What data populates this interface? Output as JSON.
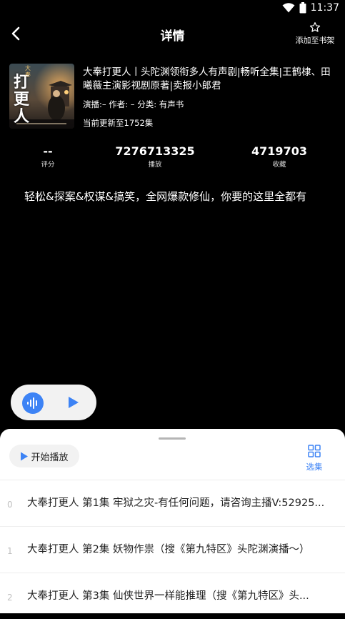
{
  "status": {
    "time": "11:37"
  },
  "nav": {
    "title": "详情",
    "shelf_label": "添加至书架"
  },
  "book": {
    "title": "大奉打更人丨头陀渊领衔多人有声剧|畅听全集|王鹤棣、田曦薇主演影视剧原著|卖报小郎君",
    "meta": "演播:–  作者: –  分类: 有声书",
    "update": "当前更新至1752集",
    "cover_text": {
      "main": "打更人",
      "top": "大奉"
    }
  },
  "stats": [
    {
      "value": "--",
      "label": "评分"
    },
    {
      "value": "7276713325",
      "label": "播放"
    },
    {
      "value": "4719703",
      "label": "收藏"
    }
  ],
  "description": "轻松&探案&权谋&搞笑，全网爆款修仙，你要的这里全都有",
  "sheet": {
    "start_label": "开始播放",
    "select_label": "选集",
    "episodes": [
      {
        "index": "0",
        "title": "大奉打更人 第1集 牢狱之灾-有任何问题，请咨询主播V:52925..."
      },
      {
        "index": "1",
        "title": "大奉打更人 第2集 妖物作祟（搜《第九特区》头陀渊演播～）"
      },
      {
        "index": "2",
        "title": "大奉打更人 第3集 仙侠世界一样能推理（搜《第九特区》头..."
      }
    ]
  },
  "colors": {
    "accent": "#3d83f5",
    "background": "#000000",
    "sheet": "#ffffff"
  }
}
